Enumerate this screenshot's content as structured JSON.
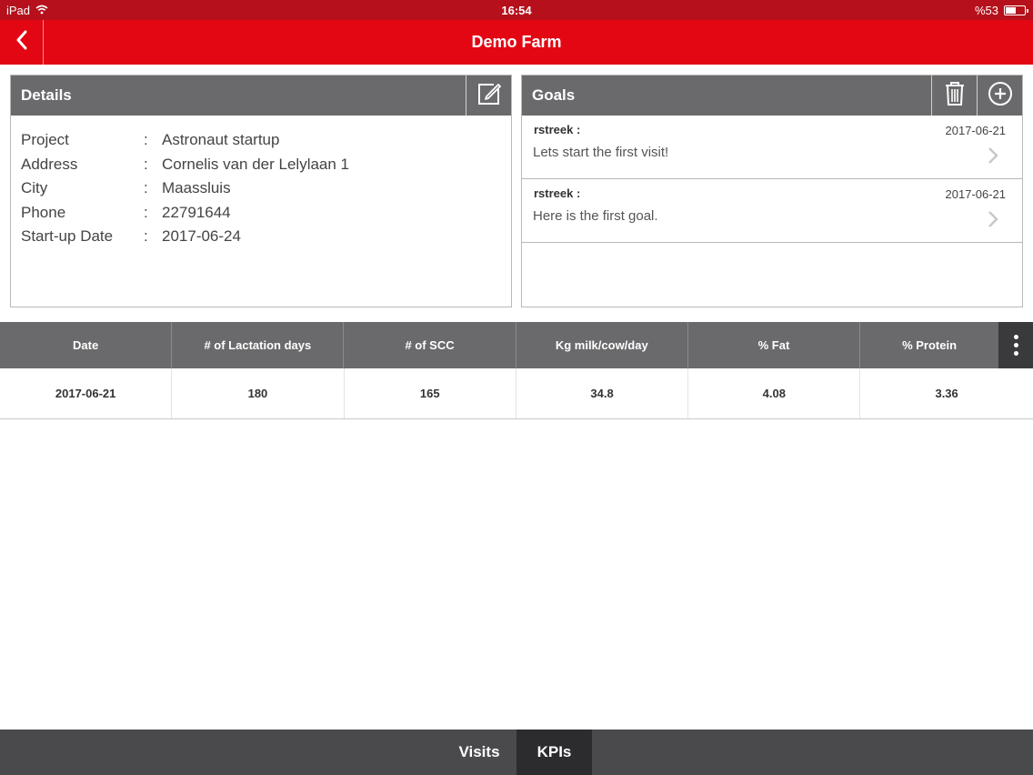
{
  "status_bar": {
    "device": "iPad",
    "time": "16:54",
    "battery": "%53",
    "battery_level": 0.53
  },
  "nav": {
    "title": "Demo Farm",
    "back_icon": "chevron-left-icon"
  },
  "details": {
    "title": "Details",
    "edit_icon": "edit-icon",
    "separator": ":",
    "fields": [
      {
        "label": "Project",
        "value": "Astronaut startup"
      },
      {
        "label": "Address",
        "value": "Cornelis van der Lelylaan 1"
      },
      {
        "label": "City",
        "value": "Maassluis"
      },
      {
        "label": "Phone",
        "value": "22791644"
      },
      {
        "label": "Start-up Date",
        "value": "2017-06-24"
      }
    ]
  },
  "goals": {
    "title": "Goals",
    "delete_icon": "trash-icon",
    "add_icon": "plus-circle-icon",
    "items": [
      {
        "author": "rstreek :",
        "date": "2017-06-21",
        "text": "Lets start the first visit!"
      },
      {
        "author": "rstreek :",
        "date": "2017-06-21",
        "text": "Here is the first goal."
      }
    ]
  },
  "kpi_table": {
    "columns": [
      "Date",
      "# of Lactation days",
      "# of SCC",
      "Kg milk/cow/day",
      "% Fat",
      "% Protein"
    ],
    "rows": [
      [
        "2017-06-21",
        "180",
        "165",
        "34.8",
        "4.08",
        "3.36"
      ]
    ],
    "more_icon": "more-vertical-icon"
  },
  "tabs": [
    {
      "label": "Visits",
      "active": false
    },
    {
      "label": "KPIs",
      "active": true
    }
  ],
  "colors": {
    "brand_red": "#e30613",
    "status_bar": "#b5101b",
    "header_gray": "#6a6a6c",
    "tabbar": "#4a4a4c",
    "tab_active": "#2c2c2e"
  }
}
